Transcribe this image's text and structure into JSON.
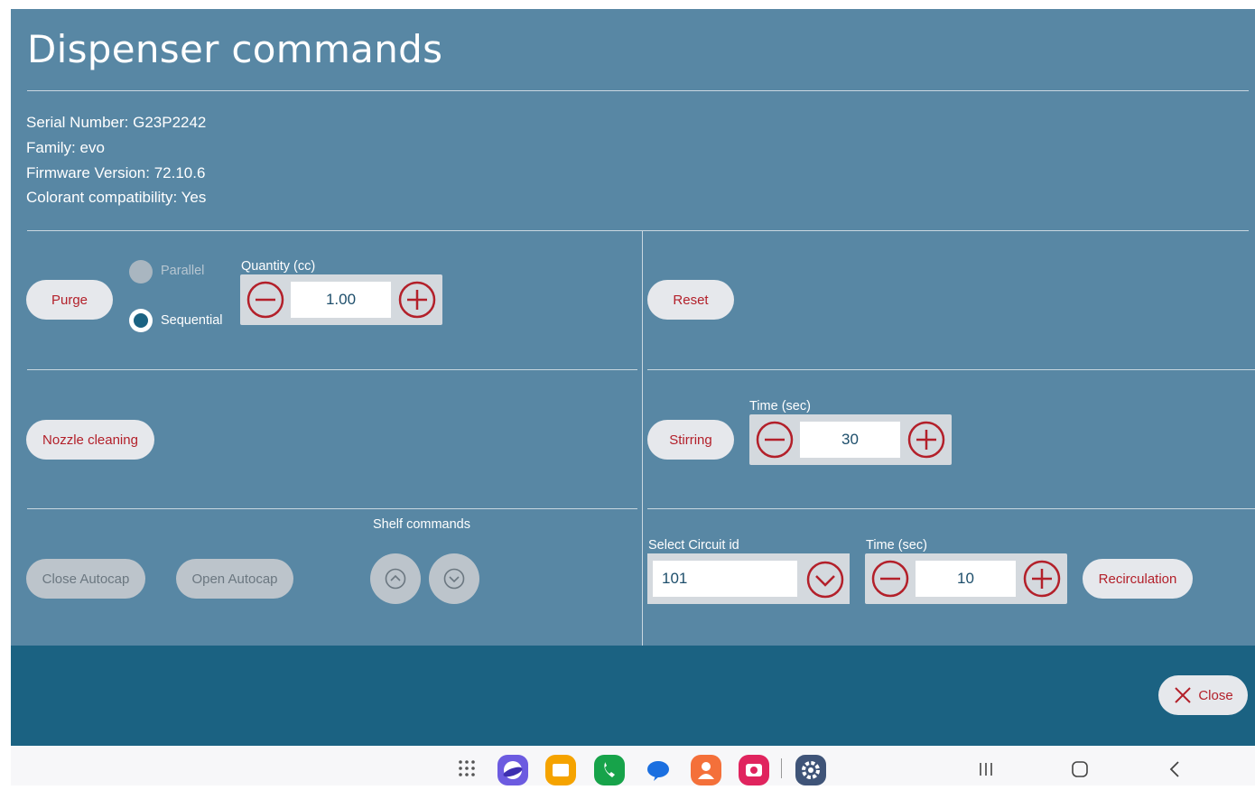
{
  "header": {
    "title": "Dispenser commands"
  },
  "info": {
    "serial": "Serial Number: G23P2242",
    "family": "Family: evo",
    "firmware": "Firmware Version: 72.10.6",
    "colorant": "Colorant compatibility: Yes"
  },
  "purge": {
    "button": "Purge",
    "parallel_label": "Parallel",
    "sequential_label": "Sequential",
    "selected_mode": "Sequential",
    "quantity_label": "Quantity (cc)",
    "quantity_value": "1.00"
  },
  "reset": {
    "button": "Reset"
  },
  "nozzle": {
    "button": "Nozzle cleaning"
  },
  "stirring": {
    "button": "Stirring",
    "time_label": "Time (sec)",
    "time_value": "30"
  },
  "autocap": {
    "close_button": "Close Autocap",
    "open_button": "Open Autocap"
  },
  "shelf": {
    "label": "Shelf commands"
  },
  "recirculation": {
    "circuit_label": "Select Circuit id",
    "circuit_value": "101",
    "time_label": "Time (sec)",
    "time_value": "10",
    "button": "Recirculation"
  },
  "footer": {
    "close_button": "Close"
  },
  "colors": {
    "panel_bg": "#5887a4",
    "footer_bg": "#1b6282",
    "accent_red": "#b3202a",
    "button_bg": "#e6e8ec"
  },
  "taskbar": {
    "apps": [
      "apps-grid-icon",
      "internet-icon",
      "my-files-icon",
      "phone-icon",
      "messages-icon",
      "contacts-icon",
      "screen-recorder-icon",
      "settings-icon"
    ]
  }
}
